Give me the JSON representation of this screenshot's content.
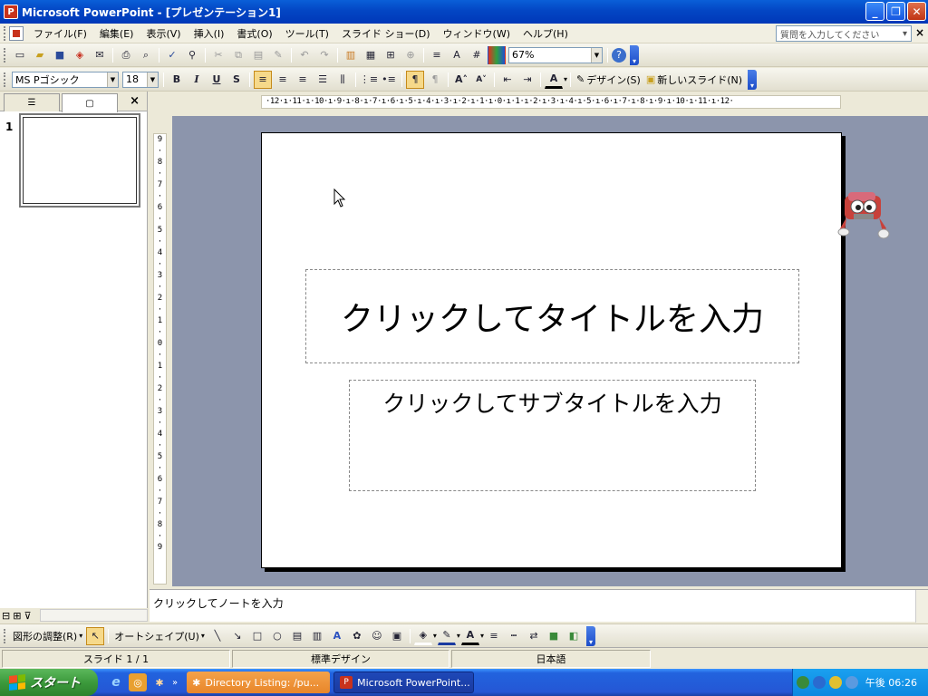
{
  "window": {
    "title": "Microsoft PowerPoint - [プレゼンテーション1]",
    "app_icon": "powerpoint-icon",
    "buttons": [
      "minimize",
      "restore",
      "close"
    ]
  },
  "menu": {
    "items": [
      "ファイル(F)",
      "編集(E)",
      "表示(V)",
      "挿入(I)",
      "書式(O)",
      "ツール(T)",
      "スライド ショー(D)",
      "ウィンドウ(W)",
      "ヘルプ(H)"
    ],
    "help_placeholder": "質問を入力してください",
    "close_glyph": "×"
  },
  "standard_toolbar": {
    "zoom": "67%"
  },
  "format_toolbar": {
    "font": "MS Pゴシック",
    "size": "18",
    "bold": "B",
    "italic": "I",
    "underline": "U",
    "shadow": "S",
    "design_label": "デザイン(S)",
    "new_slide_label": "新しいスライド(N)"
  },
  "slides_pane": {
    "slide_number": "1",
    "close_glyph": "×"
  },
  "ruler": {
    "horizontal": "·12·ı·11·ı·10·ı·9·ı·8·ı·7·ı·6·ı·5·ı·4·ı·3·ı·2·ı·1·ı·0·ı·1·ı·2·ı·3·ı·4·ı·5·ı·6·ı·7·ı·8·ı·9·ı·10·ı·11·ı·12·",
    "vertical": [
      "9",
      "·",
      "8",
      "·",
      "7",
      "·",
      "6",
      "·",
      "5",
      "·",
      "4",
      "·",
      "3",
      "·",
      "2",
      "·",
      "1",
      "·",
      "0",
      "·",
      "1",
      "·",
      "2",
      "·",
      "3",
      "·",
      "4",
      "·",
      "5",
      "·",
      "6",
      "·",
      "7",
      "·",
      "8",
      "·",
      "9"
    ]
  },
  "slide": {
    "title_placeholder": "クリックしてタイトルを入力",
    "subtitle_placeholder": "クリックしてサブタイトルを入力"
  },
  "notes": {
    "placeholder": "クリックしてノートを入力"
  },
  "drawing_toolbar": {
    "draw_menu": "図形の調整(R)",
    "autoshapes": "オートシェイプ(U)"
  },
  "status_bar": {
    "slide": "スライド 1 / 1",
    "design": "標準デザイン",
    "language": "日本語"
  },
  "taskbar": {
    "start_label": "スタート",
    "tasks": [
      "Directory Listing: /pu...",
      "Microsoft PowerPoint..."
    ],
    "clock": "午後 06:26"
  },
  "colors": {
    "titlebar": "#0346c4",
    "workspace": "#8c95ac",
    "taskbar": "#2457d5",
    "start_button": "#3c9a3c",
    "tray": "#0c88e0"
  }
}
